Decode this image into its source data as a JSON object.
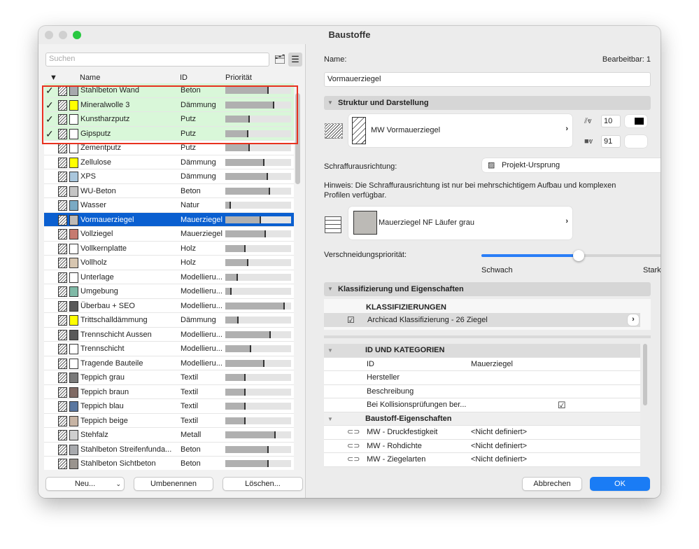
{
  "window": {
    "title": "Baustoffe"
  },
  "left": {
    "search_placeholder": "Suchen",
    "columns": {
      "name": "Name",
      "id": "ID",
      "priority": "Priorität"
    },
    "rows": [
      {
        "name": "Stahlbeton Wand",
        "id": "Beton",
        "priority": 0.66,
        "checked": true,
        "color": "#a7a9ad"
      },
      {
        "name": "Mineralwolle 3",
        "id": "Dämmung",
        "priority": 0.74,
        "checked": true,
        "color": "#ffff00"
      },
      {
        "name": "Kunstharzputz",
        "id": "Putz",
        "priority": 0.37,
        "checked": true,
        "color": "#ffffff"
      },
      {
        "name": "Gipsputz",
        "id": "Putz",
        "priority": 0.35,
        "checked": true,
        "color": "#ffffff"
      },
      {
        "name": "Zementputz",
        "id": "Putz",
        "priority": 0.37,
        "color": "#ffffff"
      },
      {
        "name": "Zellulose",
        "id": "Dämmung",
        "priority": 0.6,
        "color": "#ffff00"
      },
      {
        "name": "XPS",
        "id": "Dämmung",
        "priority": 0.65,
        "color": "#a9c6dc"
      },
      {
        "name": "WU-Beton",
        "id": "Beton",
        "priority": 0.68,
        "color": "#c4c4c4"
      },
      {
        "name": "Wasser",
        "id": "Natur",
        "priority": 0.09,
        "color": "#7aaac4"
      },
      {
        "name": "Vormauerziegel",
        "id": "Mauerziegel",
        "priority": 0.54,
        "selected": true,
        "color": "#bdbab6"
      },
      {
        "name": "Vollziegel",
        "id": "Mauerziegel",
        "priority": 0.62,
        "color": "#c77b70"
      },
      {
        "name": "Vollkernplatte",
        "id": "Holz",
        "priority": 0.31,
        "color": "#ffffff"
      },
      {
        "name": "Vollholz",
        "id": "Holz",
        "priority": 0.35,
        "color": "#d7c6b0"
      },
      {
        "name": "Unterlage",
        "id": "Modellieru...",
        "priority": 0.19,
        "color": "#ffffff"
      },
      {
        "name": "Umgebung",
        "id": "Modellieru...",
        "priority": 0.1,
        "color": "#7fb9a6"
      },
      {
        "name": "Überbau + SEO",
        "id": "Modellieru...",
        "priority": 0.9,
        "color": "#5a5a5a"
      },
      {
        "name": "Trittschalldämmung",
        "id": "Dämmung",
        "priority": 0.2,
        "color": "#ffff00"
      },
      {
        "name": "Trennschicht Aussen",
        "id": "Modellieru...",
        "priority": 0.69,
        "color": "#5a5a5a"
      },
      {
        "name": "Trennschicht",
        "id": "Modellieru...",
        "priority": 0.39,
        "color": "#ffffff"
      },
      {
        "name": "Tragende Bauteile",
        "id": "Modellieru...",
        "priority": 0.6,
        "color": "#ffffff"
      },
      {
        "name": "Teppich grau",
        "id": "Textil",
        "priority": 0.31,
        "color": "#7a7a7a"
      },
      {
        "name": "Teppich braun",
        "id": "Textil",
        "priority": 0.31,
        "color": "#806a64"
      },
      {
        "name": "Teppich blau",
        "id": "Textil",
        "priority": 0.31,
        "color": "#5a77a0"
      },
      {
        "name": "Teppich beige",
        "id": "Textil",
        "priority": 0.31,
        "color": "#c7b4a4"
      },
      {
        "name": "Stehfalz",
        "id": "Metall",
        "priority": 0.77,
        "color": "#cfcfcf"
      },
      {
        "name": "Stahlbeton Streifenfunda...",
        "id": "Beton",
        "priority": 0.66,
        "color": "#a7a9ad"
      },
      {
        "name": "Stahlbeton Sichtbeton",
        "id": "Beton",
        "priority": 0.66,
        "color": "#9a948e"
      }
    ],
    "buttons": {
      "new": "Neu...",
      "rename": "Umbenennen",
      "delete": "Löschen..."
    }
  },
  "right": {
    "name_label": "Name:",
    "editable": "Bearbeitbar: 1",
    "name_value": "Vormauerziegel",
    "section1": "Struktur und Darstellung",
    "fill_name": "MW Vormauerziegel",
    "pen1": "10",
    "pen2": "91",
    "hatch_label": "Schraffurausrichtung:",
    "hatch_value": "Projekt-Ursprung",
    "hint": "Hinweis: Die Schraffurausrichtung ist nur bei mehrschichtigem Aufbau und komplexen Profilen verfügbar.",
    "surface_name": "Mauerziegel NF Läufer grau",
    "priority_label": "Verschneidungspriorität:",
    "priority_value": "540",
    "priority_fraction": 0.54,
    "weak": "Schwach",
    "strong": "Stark",
    "section2": "Klassifizierung und Eigenschaften",
    "class_header": "KLASSIFIZIERUNGEN",
    "class_item": "Archicad Klassifizierung - 26 Ziegel",
    "id_header": "ID UND KATEGORIEN",
    "props": [
      {
        "name": "ID",
        "value": "Mauerziegel"
      },
      {
        "name": "Hersteller",
        "value": ""
      },
      {
        "name": "Beschreibung",
        "value": ""
      },
      {
        "name": "Bei Kollisionsprüfungen ber...",
        "value": ""
      }
    ],
    "group": "Baustoff-Eigenschaften",
    "linked": [
      {
        "name": "MW - Druckfestigkeit",
        "value": "<Nicht definiert>"
      },
      {
        "name": "MW - Rohdichte",
        "value": "<Nicht definiert>"
      },
      {
        "name": "MW - Ziegelarten",
        "value": "<Nicht definiert>"
      }
    ],
    "cancel": "Abbrechen",
    "ok": "OK"
  }
}
